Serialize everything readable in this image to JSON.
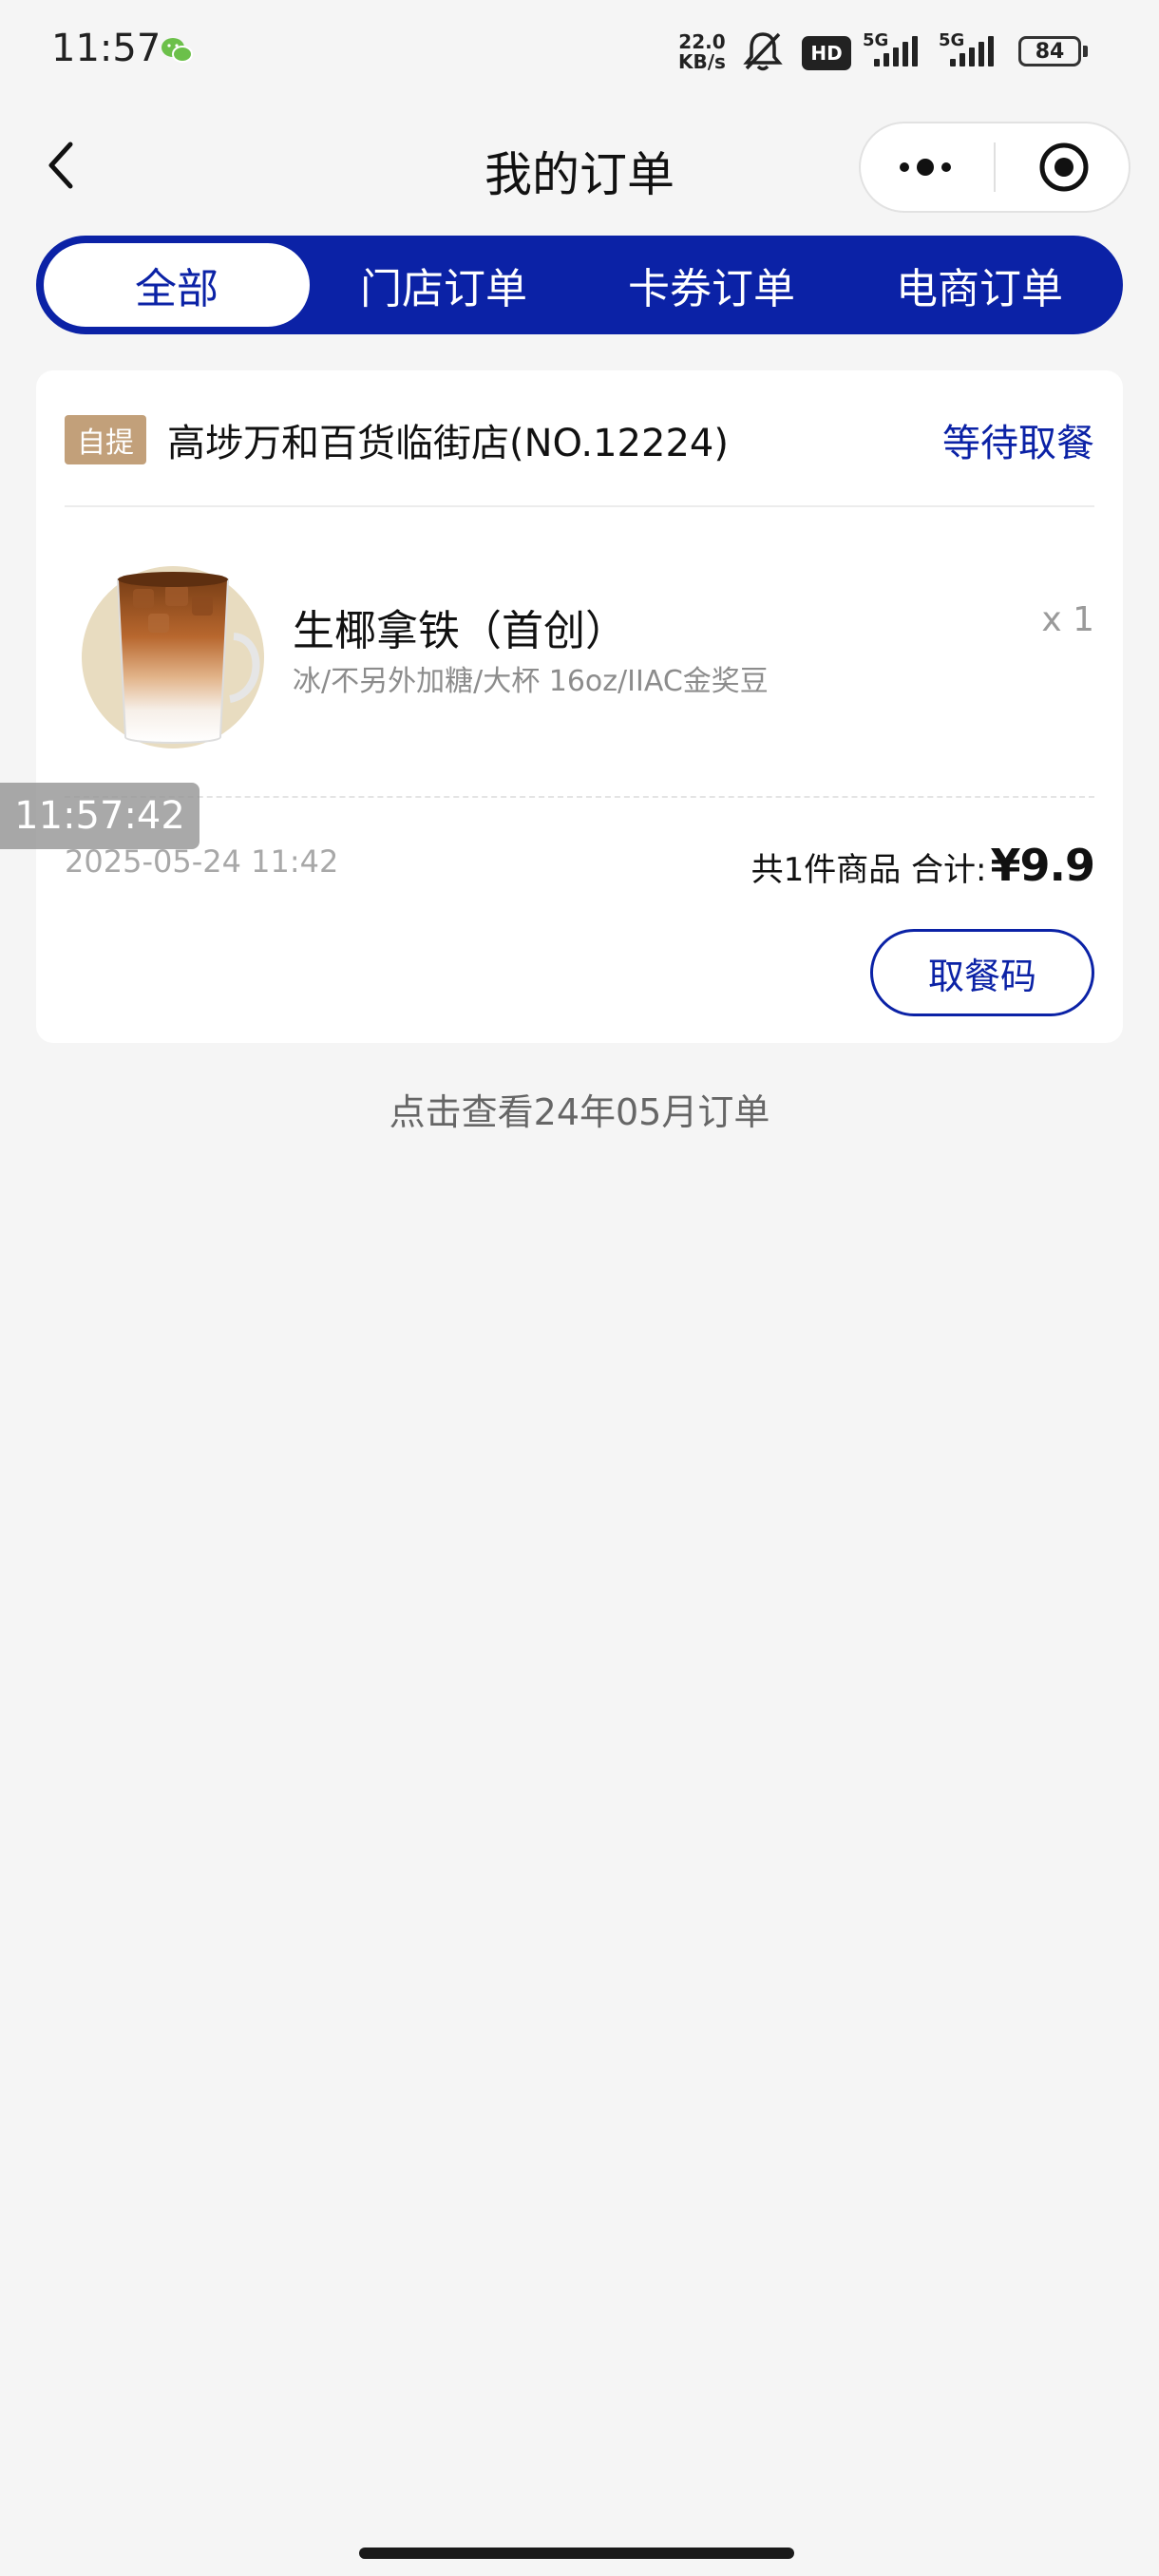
{
  "status_bar": {
    "time": "11:57",
    "net_speed_value": "22.0",
    "net_speed_unit": "KB/s",
    "hd_label": "HD",
    "signal_1_label": "5G",
    "signal_2_label": "5G",
    "battery": "84",
    "icons": [
      "wechat-icon",
      "mute-icon",
      "hd-icon",
      "signal-icon",
      "battery-icon"
    ]
  },
  "nav": {
    "title": "我的订单",
    "icons": [
      "back-icon",
      "more-icon",
      "close-icon"
    ]
  },
  "tabs": [
    {
      "label": "全部",
      "active": true
    },
    {
      "label": "门店订单",
      "active": false
    },
    {
      "label": "卡券订单",
      "active": false
    },
    {
      "label": "电商订单",
      "active": false
    }
  ],
  "order": {
    "badge": "自提",
    "store_name": "高埗万和百货临街店(NO.12224)",
    "status": "等待取餐",
    "item": {
      "name": "生椰拿铁（首创）",
      "spec": "冰/不另外加糖/大杯 16oz/IIAC金奖豆",
      "qty": "x 1"
    },
    "date": "2025-05-24 11:42",
    "summary_label": "共1件商品 合计:",
    "total": "¥9.9",
    "action_label": "取餐码"
  },
  "overlay_time": "11:57:42",
  "history_link": "点击查看24年05月订单",
  "colors": {
    "brand_blue": "#0b22a6",
    "badge_tan": "#c2a07a",
    "background": "#f5f5f5"
  }
}
